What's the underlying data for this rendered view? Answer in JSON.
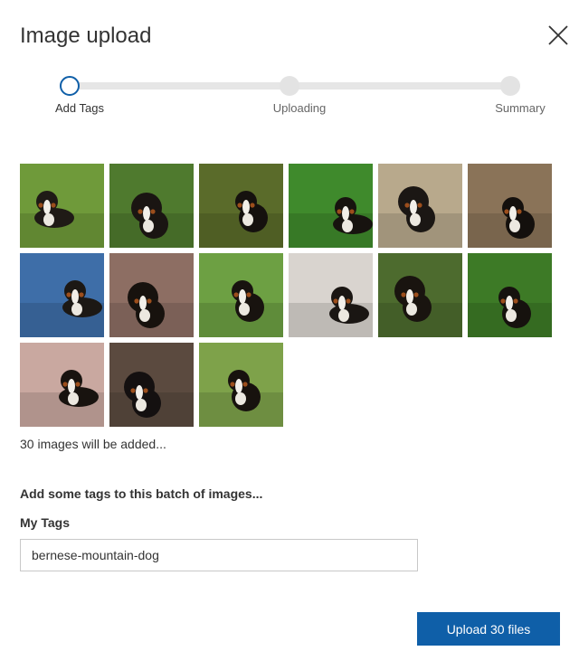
{
  "dialog": {
    "title": "Image upload",
    "close_icon": "close-icon"
  },
  "stepper": {
    "steps": [
      {
        "label": "Add Tags",
        "active": true
      },
      {
        "label": "Uploading",
        "active": false
      },
      {
        "label": "Summary",
        "active": false
      }
    ],
    "active_color": "#0f5fa8",
    "inactive_color": "#e3e3e3"
  },
  "images": {
    "thumbnails": [
      {
        "subject": "dog walking on grass path",
        "bg": "#6f9a3a",
        "dog": "#1f1a16"
      },
      {
        "subject": "dog lying on grass",
        "bg": "#4f7a2e",
        "dog": "#1a1512"
      },
      {
        "subject": "dog face close-up",
        "bg": "#5a6b2a",
        "dog": "#15110e"
      },
      {
        "subject": "dog face in grass",
        "bg": "#3f8a2c",
        "dog": "#17130f"
      },
      {
        "subject": "dog on gravel",
        "bg": "#b8a98c",
        "dog": "#1b1714"
      },
      {
        "subject": "dog sitting on dirt",
        "bg": "#8a7358",
        "dog": "#14100d"
      },
      {
        "subject": "dog walking by water",
        "bg": "#3e6ea8",
        "dog": "#1c1814"
      },
      {
        "subject": "dog portrait indoors",
        "bg": "#8d6e63",
        "dog": "#17120e"
      },
      {
        "subject": "dog sitting on lawn",
        "bg": "#6da043",
        "dog": "#18130f"
      },
      {
        "subject": "puppy lying on floor",
        "bg": "#d9d4cf",
        "dog": "#1a1613"
      },
      {
        "subject": "dog sitting in yard",
        "bg": "#4d6b2e",
        "dog": "#19140f"
      },
      {
        "subject": "dog lying in grass",
        "bg": "#3d7a26",
        "dog": "#16120e"
      },
      {
        "subject": "puppy held by hand",
        "bg": "#c9a8a0",
        "dog": "#18130f"
      },
      {
        "subject": "dog on wooden deck",
        "bg": "#5b4a3f",
        "dog": "#141010"
      },
      {
        "subject": "puppy on stones",
        "bg": "#7ea24a",
        "dog": "#17120e"
      }
    ],
    "count_note": "30 images will be added..."
  },
  "tags": {
    "heading": "Add some tags to this batch of images...",
    "label": "My Tags",
    "value": "bernese-mountain-dog",
    "placeholder": ""
  },
  "actions": {
    "upload_label": "Upload 30 files",
    "upload_color": "#0f5fa8"
  }
}
